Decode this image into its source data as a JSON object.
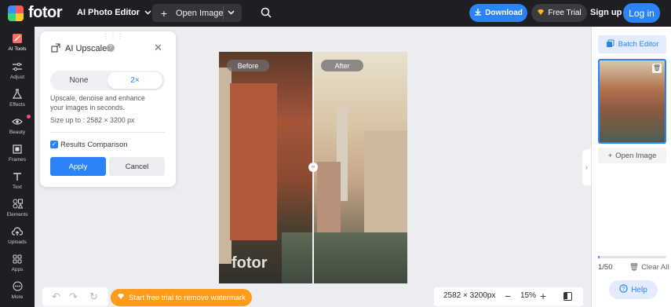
{
  "app": {
    "logo_text": "fotor",
    "editor_menu": "AI Photo Editor"
  },
  "topbar": {
    "open_image": "Open Image",
    "download": "Download",
    "free_trial": "Free Trial",
    "sign_up": "Sign up",
    "log_in": "Log in"
  },
  "sidebar": {
    "items": [
      {
        "label": "AI Tools",
        "icon": "ai-tools-icon"
      },
      {
        "label": "Adjust",
        "icon": "sliders-icon"
      },
      {
        "label": "Effects",
        "icon": "flask-icon"
      },
      {
        "label": "Beauty",
        "icon": "eye-icon"
      },
      {
        "label": "Frames",
        "icon": "frame-icon"
      },
      {
        "label": "Text",
        "icon": "text-icon"
      },
      {
        "label": "Elements",
        "icon": "shapes-icon"
      },
      {
        "label": "Uploads",
        "icon": "upload-icon"
      },
      {
        "label": "Apps",
        "icon": "apps-icon"
      },
      {
        "label": "More",
        "icon": "more-icon"
      }
    ]
  },
  "panel": {
    "title": "AI Upscaler",
    "options": [
      "None",
      "2×"
    ],
    "selected_option": "2×",
    "description": "Upscale, denoise and enhance your images in seconds.",
    "size_limit": "Size up to : 2582 × 3200 px",
    "results_comparison": "Results Comparison",
    "results_comparison_checked": true,
    "apply": "Apply",
    "cancel": "Cancel"
  },
  "canvas": {
    "before_label": "Before",
    "after_label": "After",
    "watermark": "fotor"
  },
  "bottombar": {
    "watermark_cta": "Start free trial to remove watermark",
    "dimensions": "2582 × 3200px",
    "zoom": "15%"
  },
  "right_panel": {
    "batch_editor": "Batch Editor",
    "open_image": "Open Image",
    "count": "1/50",
    "clear_all": "Clear All",
    "help": "Help",
    "progress_fraction": 0.02
  },
  "colors": {
    "accent": "#2c82f7",
    "topbar": "#1e1e23",
    "cta_orange": "#ff9b1a"
  }
}
